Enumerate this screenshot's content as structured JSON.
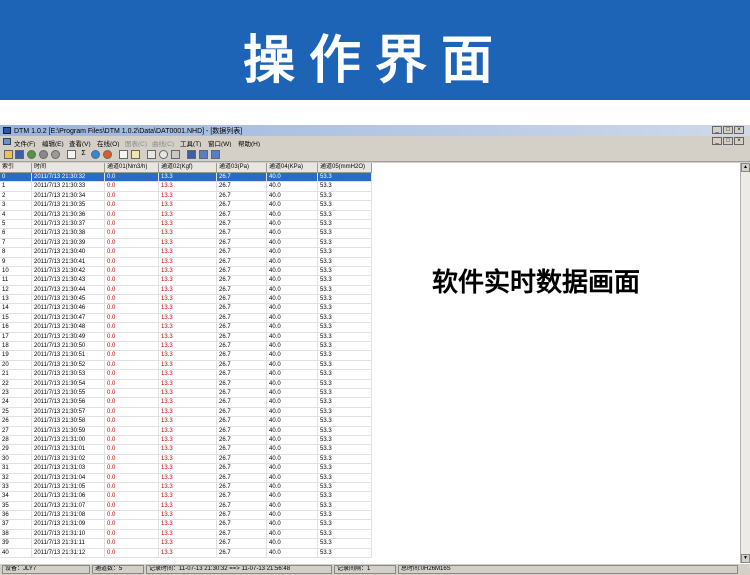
{
  "banner": {
    "title": "操作界面"
  },
  "overlay": {
    "caption": "软件实时数据画面"
  },
  "window": {
    "title": "DTM 1.0.2 [E:\\Program Files\\DTM 1.0.2\\Data\\DAT0001.NHD] - [数据列表]",
    "controls": [
      "_",
      "□",
      "×"
    ]
  },
  "menu": [
    {
      "label": "文件(F)",
      "enabled": true
    },
    {
      "label": "编辑(E)",
      "enabled": true
    },
    {
      "label": "查看(V)",
      "enabled": true
    },
    {
      "label": "在线(O)",
      "enabled": true
    },
    {
      "label": "图表(C)",
      "enabled": false
    },
    {
      "label": "曲线(C)",
      "enabled": false
    },
    {
      "label": "工具(T)",
      "enabled": true
    },
    {
      "label": "窗口(W)",
      "enabled": true
    },
    {
      "label": "帮助(H)",
      "enabled": true
    }
  ],
  "toolbar": {
    "icons": [
      "open-icon",
      "save-icon",
      "record-icon",
      "stop-icon",
      "pause-icon",
      "table-icon",
      "sum-icon",
      "info-icon",
      "chart-icon",
      "print-preview-icon",
      "copy-icon",
      "zoom-icon",
      "search-icon",
      "tools-icon",
      "window-cascade-icon",
      "window-tile-icon",
      "window-split-icon"
    ]
  },
  "table": {
    "columns": [
      "索引",
      "时间",
      "通道01(Nm3/h)",
      "通道02(Kgf)",
      "通道03(Pa)",
      "通道04(KPa)",
      "通道05(mmH2O)"
    ],
    "rows": [
      [
        "0",
        "2011/7/13 21:30:32",
        "0.0",
        "13.3",
        "26.7",
        "40.0",
        "53.3"
      ],
      [
        "1",
        "2011/7/13 21:30:33",
        "0.0",
        "13.3",
        "26.7",
        "40.0",
        "53.3"
      ],
      [
        "2",
        "2011/7/13 21:30:34",
        "0.0",
        "13.3",
        "26.7",
        "40.0",
        "53.3"
      ],
      [
        "3",
        "2011/7/13 21:30:35",
        "0.0",
        "13.3",
        "26.7",
        "40.0",
        "53.3"
      ],
      [
        "4",
        "2011/7/13 21:30:36",
        "0.0",
        "13.3",
        "26.7",
        "40.0",
        "53.3"
      ],
      [
        "5",
        "2011/7/13 21:30:37",
        "0.0",
        "13.3",
        "26.7",
        "40.0",
        "53.3"
      ],
      [
        "6",
        "2011/7/13 21:30:38",
        "0.0",
        "13.3",
        "26.7",
        "40.0",
        "53.3"
      ],
      [
        "7",
        "2011/7/13 21:30:39",
        "0.0",
        "13.3",
        "26.7",
        "40.0",
        "53.3"
      ],
      [
        "8",
        "2011/7/13 21:30:40",
        "0.0",
        "13.3",
        "26.7",
        "40.0",
        "53.3"
      ],
      [
        "9",
        "2011/7/13 21:30:41",
        "0.0",
        "13.3",
        "26.7",
        "40.0",
        "53.3"
      ],
      [
        "10",
        "2011/7/13 21:30:42",
        "0.0",
        "13.3",
        "26.7",
        "40.0",
        "53.3"
      ],
      [
        "11",
        "2011/7/13 21:30:43",
        "0.0",
        "13.3",
        "26.7",
        "40.0",
        "53.3"
      ],
      [
        "12",
        "2011/7/13 21:30:44",
        "0.0",
        "13.3",
        "26.7",
        "40.0",
        "53.3"
      ],
      [
        "13",
        "2011/7/13 21:30:45",
        "0.0",
        "13.3",
        "26.7",
        "40.0",
        "53.3"
      ],
      [
        "14",
        "2011/7/13 21:30:46",
        "0.0",
        "13.3",
        "26.7",
        "40.0",
        "53.3"
      ],
      [
        "15",
        "2011/7/13 21:30:47",
        "0.0",
        "13.3",
        "26.7",
        "40.0",
        "53.3"
      ],
      [
        "16",
        "2011/7/13 21:30:48",
        "0.0",
        "13.3",
        "26.7",
        "40.0",
        "53.3"
      ],
      [
        "17",
        "2011/7/13 21:30:49",
        "0.0",
        "13.3",
        "26.7",
        "40.0",
        "53.3"
      ],
      [
        "18",
        "2011/7/13 21:30:50",
        "0.0",
        "13.3",
        "26.7",
        "40.0",
        "53.3"
      ],
      [
        "19",
        "2011/7/13 21:30:51",
        "0.0",
        "13.3",
        "26.7",
        "40.0",
        "53.3"
      ],
      [
        "20",
        "2011/7/13 21:30:52",
        "0.0",
        "13.3",
        "26.7",
        "40.0",
        "53.3"
      ],
      [
        "21",
        "2011/7/13 21:30:53",
        "0.0",
        "13.3",
        "26.7",
        "40.0",
        "53.3"
      ],
      [
        "22",
        "2011/7/13 21:30:54",
        "0.0",
        "13.3",
        "26.7",
        "40.0",
        "53.3"
      ],
      [
        "23",
        "2011/7/13 21:30:55",
        "0.0",
        "13.3",
        "26.7",
        "40.0",
        "53.3"
      ],
      [
        "24",
        "2011/7/13 21:30:56",
        "0.0",
        "13.3",
        "26.7",
        "40.0",
        "53.3"
      ],
      [
        "25",
        "2011/7/13 21:30:57",
        "0.0",
        "13.3",
        "26.7",
        "40.0",
        "53.3"
      ],
      [
        "26",
        "2011/7/13 21:30:58",
        "0.0",
        "13.3",
        "26.7",
        "40.0",
        "53.3"
      ],
      [
        "27",
        "2011/7/13 21:30:59",
        "0.0",
        "13.3",
        "26.7",
        "40.0",
        "53.3"
      ],
      [
        "28",
        "2011/7/13 21:31:00",
        "0.0",
        "13.3",
        "26.7",
        "40.0",
        "53.3"
      ],
      [
        "29",
        "2011/7/13 21:31:01",
        "0.0",
        "13.3",
        "26.7",
        "40.0",
        "53.3"
      ],
      [
        "30",
        "2011/7/13 21:31:02",
        "0.0",
        "13.3",
        "26.7",
        "40.0",
        "53.3"
      ],
      [
        "31",
        "2011/7/13 21:31:03",
        "0.0",
        "13.3",
        "26.7",
        "40.0",
        "53.3"
      ],
      [
        "32",
        "2011/7/13 21:31:04",
        "0.0",
        "13.3",
        "26.7",
        "40.0",
        "53.3"
      ],
      [
        "33",
        "2011/7/13 21:31:05",
        "0.0",
        "13.3",
        "26.7",
        "40.0",
        "53.3"
      ],
      [
        "34",
        "2011/7/13 21:31:06",
        "0.0",
        "13.3",
        "26.7",
        "40.0",
        "53.3"
      ],
      [
        "35",
        "2011/7/13 21:31:07",
        "0.0",
        "13.3",
        "26.7",
        "40.0",
        "53.3"
      ],
      [
        "36",
        "2011/7/13 21:31:08",
        "0.0",
        "13.3",
        "26.7",
        "40.0",
        "53.3"
      ],
      [
        "37",
        "2011/7/13 21:31:09",
        "0.0",
        "13.3",
        "26.7",
        "40.0",
        "53.3"
      ],
      [
        "38",
        "2011/7/13 21:31:10",
        "0.0",
        "13.3",
        "26.7",
        "40.0",
        "53.3"
      ],
      [
        "39",
        "2011/7/13 21:31:11",
        "0.0",
        "13.3",
        "26.7",
        "40.0",
        "53.3"
      ],
      [
        "40",
        "2011/7/13 21:31:12",
        "0.0",
        "13.3",
        "26.7",
        "40.0",
        "53.3"
      ]
    ],
    "selected_index": 0,
    "colors": {
      "selection": "#2f69c6",
      "red_values": "#c00000"
    }
  },
  "status": {
    "device": "设备：JLY7",
    "channels": "通道数：5",
    "record_time": "记录时间：11-07-13 21:30:32 ==> 11-07-13 21:56:48",
    "interval": "记录间隔：1",
    "total_time": "总时间:0H26M16S"
  },
  "colors": {
    "banner": "#1d63b6"
  }
}
